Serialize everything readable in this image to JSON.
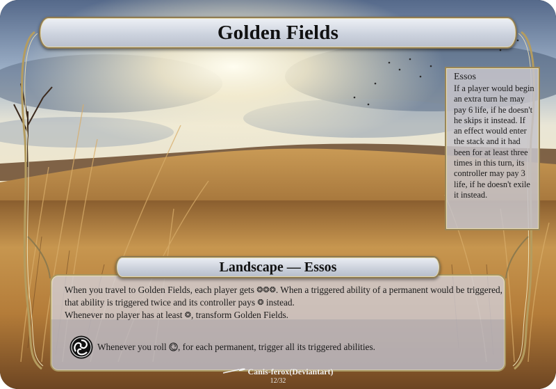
{
  "card": {
    "title": "Golden Fields",
    "type_line": "Landscape — Essos",
    "side_box": {
      "heading": "Essos",
      "body": "If a player would begin an extra turn he may pay 6 life, if he doesn't he skips it instead. If an effect would enter the stack and it had been for at least three times in this turn, its controller may pay 3 life, if he doesn't exile it instead."
    },
    "rules": {
      "line1_a": "When you travel to Golden Fields, each player gets ",
      "line1_b": ". When a triggered ability of a permanent would be triggered, that ability is triggered twice and its controller pays ",
      "line1_c": " instead.",
      "line2_a": "Whenever no player has at least ",
      "line2_b": ", transform Golden Fields.",
      "energy_symbol": "❂",
      "energy_triple": "❂❂❂"
    },
    "chaos": {
      "text_a": "Whenever you roll ",
      "text_b": ", for each permanent, trigger all its triggered abilities.",
      "icon": "chaos-symbol-icon"
    },
    "artist": "Canis-ferox(Deviantart)",
    "number": "12/32"
  },
  "colors": {
    "border": "#0d0d0d",
    "frame_gold": "#a8955f",
    "sky": "#8fa7c4",
    "field": "#b9873f"
  }
}
